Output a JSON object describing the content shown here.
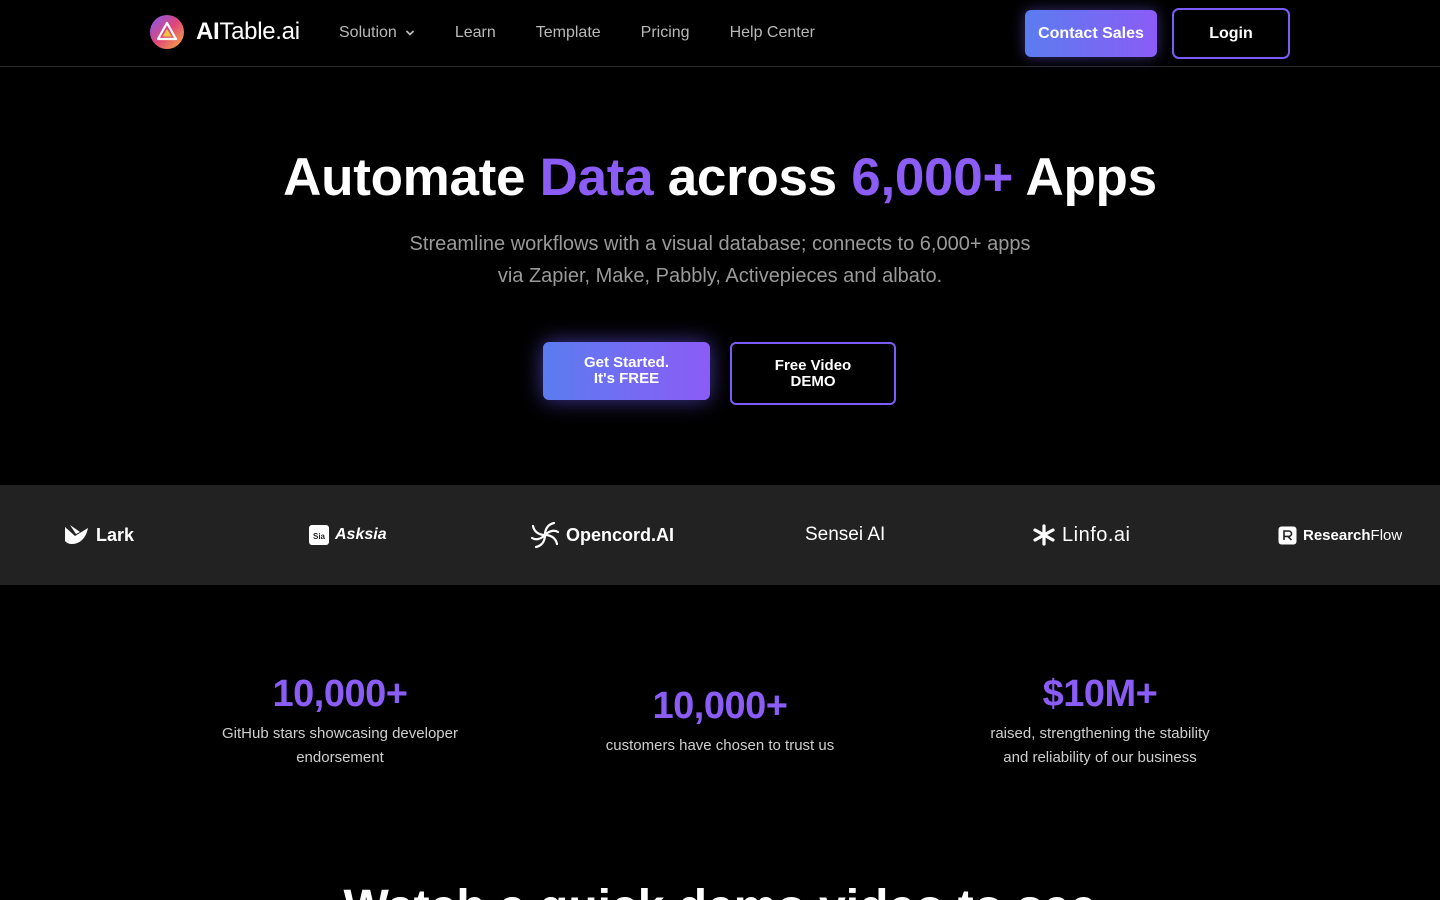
{
  "nav": {
    "logo_bold": "AI",
    "logo_rest": "Table.ai",
    "links": [
      {
        "label": "Solution",
        "has_dropdown": true
      },
      {
        "label": "Learn"
      },
      {
        "label": "Template"
      },
      {
        "label": "Pricing"
      },
      {
        "label": "Help Center"
      }
    ],
    "contact_label": "Contact Sales",
    "login_label": "Login"
  },
  "hero": {
    "title_parts": [
      "Automate ",
      "Data",
      " across ",
      "6,000+",
      " Apps"
    ],
    "subtitle_line1": "Streamline workflows with a visual database; connects to 6,000+ apps",
    "subtitle_line2": "via Zapier, Make, Pabbly, Activepieces and albato.",
    "cta_primary_line1": "Get Started.",
    "cta_primary_line2": "It's FREE",
    "cta_secondary_line1": "Free Video",
    "cta_secondary_line2": "DEMO"
  },
  "partners": [
    {
      "name": "Lark",
      "icon": "lark-bird-icon"
    },
    {
      "name": "Asksia",
      "icon": "sia-badge-icon"
    },
    {
      "name": "Opencord.AI",
      "icon": "spiral-icon"
    },
    {
      "name": "Sensei AI",
      "icon": ""
    },
    {
      "name": "Linfo.ai",
      "icon": "star-burst-icon"
    },
    {
      "name_bold": "Research",
      "name_light": "Flow",
      "icon": "r-square-icon"
    }
  ],
  "stats": [
    {
      "value": "10,000+",
      "desc_line1": "GitHub stars showcasing developer",
      "desc_line2": "endorsement"
    },
    {
      "value": "10,000+",
      "desc_line1": "customers have chosen to trust us",
      "desc_line2": ""
    },
    {
      "value": "$10M+",
      "desc_line1": "raised, strengthening the stability",
      "desc_line2": "and reliability of our business"
    }
  ],
  "section": {
    "title": "Watch a quick demo video to see"
  },
  "colors": {
    "accent": "#8b5cf6",
    "gradient_start": "#5b7cf0",
    "gradient_end": "#8b5cf6",
    "background": "#000000",
    "strip_bg": "#222222"
  }
}
